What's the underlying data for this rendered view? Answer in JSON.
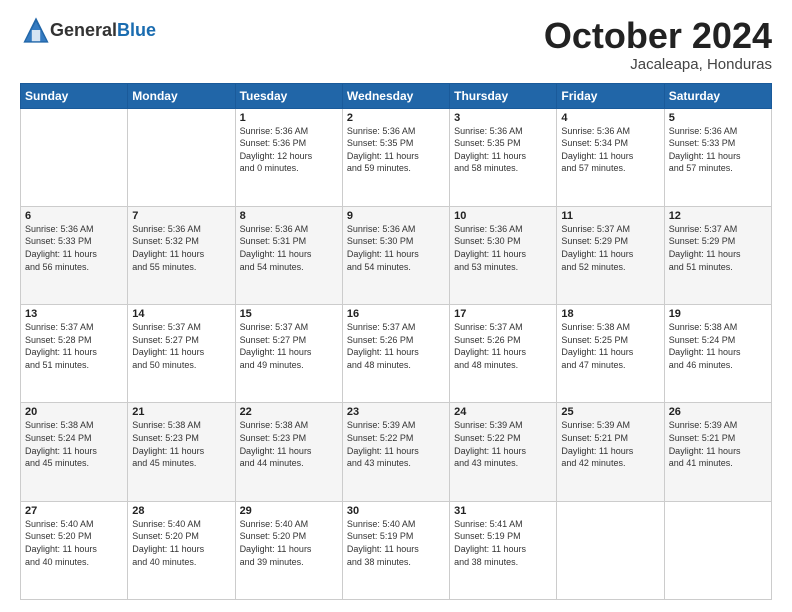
{
  "header": {
    "logo_general": "General",
    "logo_blue": "Blue",
    "month": "October 2024",
    "location": "Jacaleapa, Honduras"
  },
  "weekdays": [
    "Sunday",
    "Monday",
    "Tuesday",
    "Wednesday",
    "Thursday",
    "Friday",
    "Saturday"
  ],
  "weeks": [
    [
      {
        "day": "",
        "info": ""
      },
      {
        "day": "",
        "info": ""
      },
      {
        "day": "1",
        "info": "Sunrise: 5:36 AM\nSunset: 5:36 PM\nDaylight: 12 hours\nand 0 minutes."
      },
      {
        "day": "2",
        "info": "Sunrise: 5:36 AM\nSunset: 5:35 PM\nDaylight: 11 hours\nand 59 minutes."
      },
      {
        "day": "3",
        "info": "Sunrise: 5:36 AM\nSunset: 5:35 PM\nDaylight: 11 hours\nand 58 minutes."
      },
      {
        "day": "4",
        "info": "Sunrise: 5:36 AM\nSunset: 5:34 PM\nDaylight: 11 hours\nand 57 minutes."
      },
      {
        "day": "5",
        "info": "Sunrise: 5:36 AM\nSunset: 5:33 PM\nDaylight: 11 hours\nand 57 minutes."
      }
    ],
    [
      {
        "day": "6",
        "info": "Sunrise: 5:36 AM\nSunset: 5:33 PM\nDaylight: 11 hours\nand 56 minutes."
      },
      {
        "day": "7",
        "info": "Sunrise: 5:36 AM\nSunset: 5:32 PM\nDaylight: 11 hours\nand 55 minutes."
      },
      {
        "day": "8",
        "info": "Sunrise: 5:36 AM\nSunset: 5:31 PM\nDaylight: 11 hours\nand 54 minutes."
      },
      {
        "day": "9",
        "info": "Sunrise: 5:36 AM\nSunset: 5:30 PM\nDaylight: 11 hours\nand 54 minutes."
      },
      {
        "day": "10",
        "info": "Sunrise: 5:36 AM\nSunset: 5:30 PM\nDaylight: 11 hours\nand 53 minutes."
      },
      {
        "day": "11",
        "info": "Sunrise: 5:37 AM\nSunset: 5:29 PM\nDaylight: 11 hours\nand 52 minutes."
      },
      {
        "day": "12",
        "info": "Sunrise: 5:37 AM\nSunset: 5:29 PM\nDaylight: 11 hours\nand 51 minutes."
      }
    ],
    [
      {
        "day": "13",
        "info": "Sunrise: 5:37 AM\nSunset: 5:28 PM\nDaylight: 11 hours\nand 51 minutes."
      },
      {
        "day": "14",
        "info": "Sunrise: 5:37 AM\nSunset: 5:27 PM\nDaylight: 11 hours\nand 50 minutes."
      },
      {
        "day": "15",
        "info": "Sunrise: 5:37 AM\nSunset: 5:27 PM\nDaylight: 11 hours\nand 49 minutes."
      },
      {
        "day": "16",
        "info": "Sunrise: 5:37 AM\nSunset: 5:26 PM\nDaylight: 11 hours\nand 48 minutes."
      },
      {
        "day": "17",
        "info": "Sunrise: 5:37 AM\nSunset: 5:26 PM\nDaylight: 11 hours\nand 48 minutes."
      },
      {
        "day": "18",
        "info": "Sunrise: 5:38 AM\nSunset: 5:25 PM\nDaylight: 11 hours\nand 47 minutes."
      },
      {
        "day": "19",
        "info": "Sunrise: 5:38 AM\nSunset: 5:24 PM\nDaylight: 11 hours\nand 46 minutes."
      }
    ],
    [
      {
        "day": "20",
        "info": "Sunrise: 5:38 AM\nSunset: 5:24 PM\nDaylight: 11 hours\nand 45 minutes."
      },
      {
        "day": "21",
        "info": "Sunrise: 5:38 AM\nSunset: 5:23 PM\nDaylight: 11 hours\nand 45 minutes."
      },
      {
        "day": "22",
        "info": "Sunrise: 5:38 AM\nSunset: 5:23 PM\nDaylight: 11 hours\nand 44 minutes."
      },
      {
        "day": "23",
        "info": "Sunrise: 5:39 AM\nSunset: 5:22 PM\nDaylight: 11 hours\nand 43 minutes."
      },
      {
        "day": "24",
        "info": "Sunrise: 5:39 AM\nSunset: 5:22 PM\nDaylight: 11 hours\nand 43 minutes."
      },
      {
        "day": "25",
        "info": "Sunrise: 5:39 AM\nSunset: 5:21 PM\nDaylight: 11 hours\nand 42 minutes."
      },
      {
        "day": "26",
        "info": "Sunrise: 5:39 AM\nSunset: 5:21 PM\nDaylight: 11 hours\nand 41 minutes."
      }
    ],
    [
      {
        "day": "27",
        "info": "Sunrise: 5:40 AM\nSunset: 5:20 PM\nDaylight: 11 hours\nand 40 minutes."
      },
      {
        "day": "28",
        "info": "Sunrise: 5:40 AM\nSunset: 5:20 PM\nDaylight: 11 hours\nand 40 minutes."
      },
      {
        "day": "29",
        "info": "Sunrise: 5:40 AM\nSunset: 5:20 PM\nDaylight: 11 hours\nand 39 minutes."
      },
      {
        "day": "30",
        "info": "Sunrise: 5:40 AM\nSunset: 5:19 PM\nDaylight: 11 hours\nand 38 minutes."
      },
      {
        "day": "31",
        "info": "Sunrise: 5:41 AM\nSunset: 5:19 PM\nDaylight: 11 hours\nand 38 minutes."
      },
      {
        "day": "",
        "info": ""
      },
      {
        "day": "",
        "info": ""
      }
    ]
  ]
}
